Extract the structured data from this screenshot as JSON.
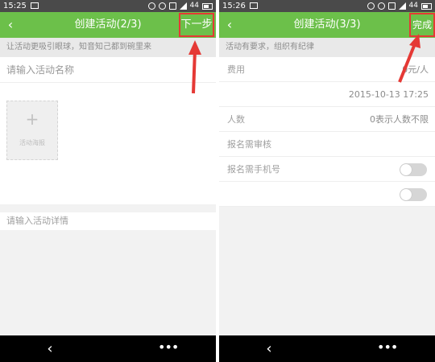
{
  "left_screen": {
    "status": {
      "time": "15:25",
      "signal": "44"
    },
    "titlebar": {
      "back_icon": "‹",
      "title": "创建活动(2/3)",
      "next_label": "下一步"
    },
    "hint": "让活动更吸引眼球，知音知己都到碗里来",
    "name_placeholder": "请输入活动名称",
    "upload": {
      "plus": "+",
      "label": "活动海报"
    },
    "detail_placeholder": "请输入活动详情"
  },
  "right_screen": {
    "status": {
      "time": "15:26",
      "signal": "44"
    },
    "titlebar": {
      "back_icon": "‹",
      "title": "创建活动(3/3)",
      "finish_label": "完成"
    },
    "hint": "活动有要求，组织有纪律",
    "rows": [
      {
        "label": "费用",
        "value": "0元/人"
      },
      {
        "label": "",
        "value": "2015-10-13 17:25"
      },
      {
        "label": "人数",
        "value": "0表示人数不限"
      },
      {
        "label": "报名需审核",
        "value": ""
      },
      {
        "label": "报名需手机号",
        "value": ""
      },
      {
        "label": "",
        "value": ""
      }
    ]
  },
  "navbar": {
    "back_icon": "‹",
    "more_icon": "•••"
  },
  "colors": {
    "accent": "#6cc04a",
    "highlight": "#e53935",
    "statusbar": "#4a4a4a"
  }
}
